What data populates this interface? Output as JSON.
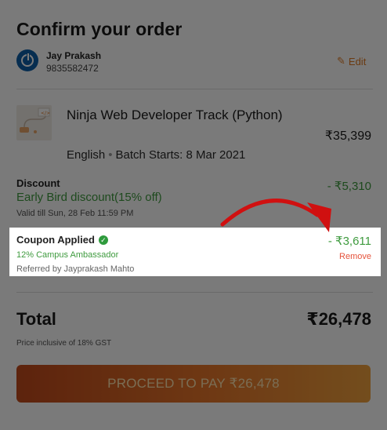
{
  "header": {
    "title": "Confirm your order"
  },
  "user": {
    "name": "Jay Prakash",
    "phone": "9835582472",
    "edit_label": "Edit",
    "avatar_icon": "power-icon"
  },
  "course": {
    "title": "Ninja Web Developer Track (Python)",
    "language": "English",
    "batch": "Batch Starts: 8 Mar 2021",
    "price": "₹35,399"
  },
  "discount": {
    "heading": "Discount",
    "name": "Early Bird discount(15% off)",
    "validity": "Valid till Sun, 28 Feb 11:59 PM",
    "amount": "- ₹5,310"
  },
  "coupon": {
    "heading": "Coupon Applied",
    "name": "12% Campus Ambassador",
    "referred_by": "Referred by Jayprakash Mahto",
    "amount": "- ₹3,611",
    "remove_label": "Remove"
  },
  "total": {
    "label": "Total",
    "value": "₹26,478",
    "note": "Price inclusive of 18% GST"
  },
  "cta": {
    "label": "PROCEED TO PAY ₹26,478"
  },
  "colors": {
    "accent": "#e07a23",
    "green": "#3f9b3f",
    "remove": "#e5533c",
    "arrow": "#d01010",
    "brand_blue": "#0e5ea8"
  }
}
